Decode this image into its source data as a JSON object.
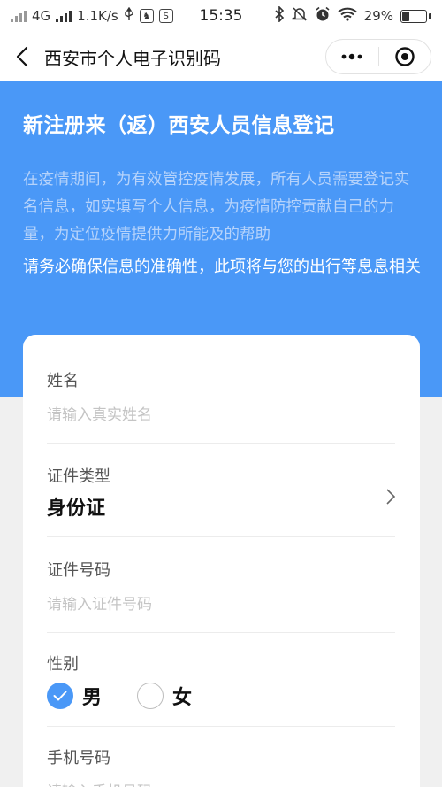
{
  "status_bar": {
    "network": "4G",
    "speed": "1.1K/s",
    "time": "15:35",
    "battery": "29%",
    "battery_level": 0.29
  },
  "nav": {
    "title": "西安市个人电子识别码"
  },
  "hero": {
    "title": "新注册来（返）西安人员信息登记",
    "description": "在疫情期间，为有效管控疫情发展，所有人员需要登记实名信息，如实填写个人信息，为疫情防控贡献自己的力量，为定位疫情提供力所能及的帮助",
    "note": "请务必确保信息的准确性，此项将与您的出行等息息相关"
  },
  "form": {
    "name": {
      "label": "姓名",
      "placeholder": "请输入真实姓名"
    },
    "id_type": {
      "label": "证件类型",
      "value": "身份证"
    },
    "id_number": {
      "label": "证件号码",
      "placeholder": "请输入证件号码"
    },
    "gender": {
      "label": "性别",
      "options": [
        "男",
        "女"
      ],
      "selected": "男"
    },
    "phone": {
      "label": "手机号码",
      "placeholder": "请输入手机号码"
    }
  },
  "colors": {
    "primary": "#4a98f7",
    "background": "#f0f0f0"
  }
}
